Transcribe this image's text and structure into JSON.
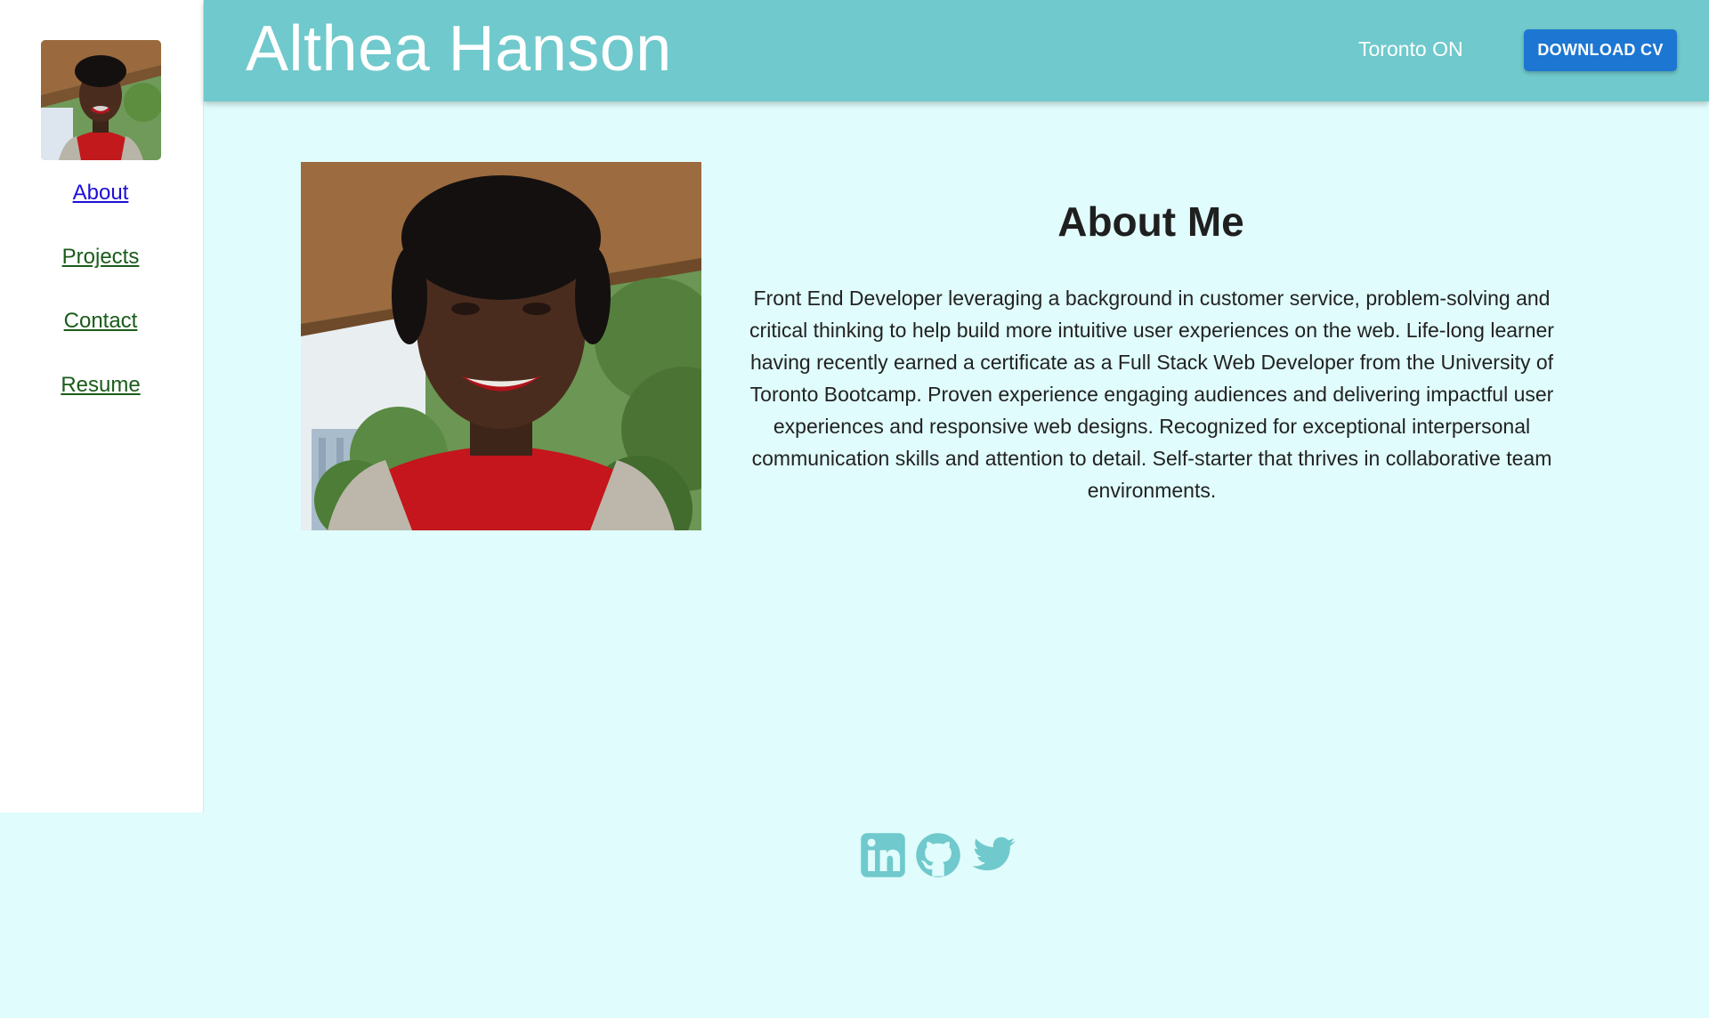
{
  "header": {
    "name": "Althea Hanson",
    "location": "Toronto ON",
    "cv_button": "DOWNLOAD CV"
  },
  "sidebar": {
    "items": [
      {
        "label": "About",
        "active": true
      },
      {
        "label": "Projects",
        "active": false
      },
      {
        "label": "Contact",
        "active": false
      },
      {
        "label": "Resume",
        "active": false
      }
    ]
  },
  "about": {
    "title": "About Me",
    "text": "Front End Developer leveraging a background in customer service, problem-solving and critical thinking to help build more intuitive user experiences on the web. Life-long learner having recently earned a certificate as a Full Stack Web Developer from the University of Toronto Bootcamp. Proven experience engaging audiences and delivering impactful user experiences and responsive web designs. Recognized for exceptional interpersonal communication skills and attention to detail. Self-starter that thrives in collaborative team environments."
  },
  "footer": {
    "icons": [
      "linkedin-icon",
      "github-icon",
      "twitter-icon"
    ]
  },
  "colors": {
    "header_bg": "#70c9cc",
    "page_bg": "#e0fcfc",
    "button_bg": "#1c76d2",
    "icon_color": "#70c9cc",
    "nav_link": "#1a5c1a",
    "nav_link_active": "#1d0fd6"
  }
}
